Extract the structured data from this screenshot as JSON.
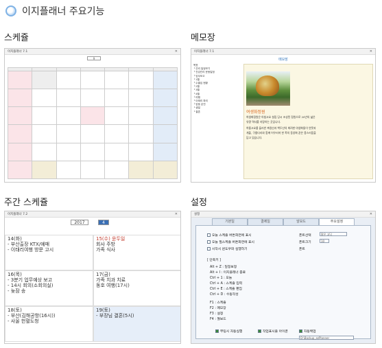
{
  "header": {
    "title": "이지플래너 주요기능"
  },
  "sections": {
    "schedule": "스케쥴",
    "memo": "메모장",
    "weekly": "주간 스케쥴",
    "settings": "설정"
  },
  "schedule_shot": {
    "window_title": "이지플래너 7.1",
    "month": "9",
    "day_headers": [
      "일",
      "월",
      "화",
      "수",
      "목",
      "금",
      "토"
    ]
  },
  "memo_shot": {
    "window_title": "이지플래너 7.1",
    "header": "메모장",
    "tree": [
      "목표",
      "└ 관리 일정보기",
      "└ 건강관리 운동일정",
      "└ 업무보고",
      "  └ 1월",
      "    └ 수출입 현황",
      "    └ 2월",
      "  └ 3월",
      "  └ 4월",
      "└ 여행",
      "  └ 이태리 파리",
      "  └ 앞동 온천",
      "└ 생일",
      "└ 결혼"
    ],
    "article_title": "여생화정원",
    "article_lines": [
      "여생화정원은 아침고요 설립 당시 조성된 정원으로 20년의 넓은",
      "유명 역사를 자랑하는 곳입니다.",
      "여름고요를 둘러싼 축령산과 백두산의 화려한 야생화들이 연못과",
      "개울, 구름다리와 함께 어우러져 한 폭의 동양화 같은 풍스러움을",
      "담고 있습니다."
    ]
  },
  "weekly_shot": {
    "window_title": "이지플래너 7.2",
    "year": "2017",
    "week_label": "4",
    "cells": [
      {
        "day": "14(화)",
        "lines": [
          "- 부산출장 KTX/예매",
          "- 이태리여행 방문 고시"
        ]
      },
      {
        "day": "15(수) 윤두일",
        "lines": [
          "회사 주방",
          "가족 식사"
        ]
      },
      {
        "day": "16(목)",
        "lines": [
          "- 3분기 업무예상 보고",
          "- 14시 회의(소회의실)",
          "- 늦잠 송"
        ]
      },
      {
        "day": "17(금)",
        "lines": [
          "가족 치과 치료",
          "동호 여행(17시)"
        ]
      },
      {
        "day": "18(토)",
        "lines": [
          "- 부산(김해공항(16시))",
          "- 사울 헌혈도청"
        ]
      },
      {
        "day": "19(토)",
        "lines": [
          "- 부장님 결혼(5시)"
        ]
      }
    ]
  },
  "settings_shot": {
    "window_title": "설정",
    "tabs": [
      "기본일",
      "결제일",
      "암보드",
      "주요설정"
    ],
    "options": [
      "오늘 스케쥴 버튼화면에 표시",
      "오늘 필스케쥴 버튼화면에 표시",
      "시작시 윈도우와 실행하기"
    ],
    "fields": [
      "폰트선택",
      "폰트크기",
      "폰트"
    ],
    "font_value": "맑은 고딕",
    "size_value": "10",
    "hotkey_header": "[ 단축키 ]",
    "hotkeys": [
      "Alt + Z : 일정보정",
      "Alt + I : 이지플래너 종료",
      "Ctrl + 1 : 오늘",
      "Ctrl + A : 스케쥴 입력",
      "Ctrl + E : 스케쥴 편집",
      "Ctrl + D : 수동작성"
    ],
    "fkeys": [
      "F1 : 스케쥴",
      "F2 : 메모장",
      "F3 : 설정",
      "F4 : 월보드"
    ],
    "bottom": [
      "부팅시 자동실행",
      "작업표시줄 아이콘",
      "자동백업"
    ],
    "backup_path": "D:\\Backup_ezPlanner"
  }
}
